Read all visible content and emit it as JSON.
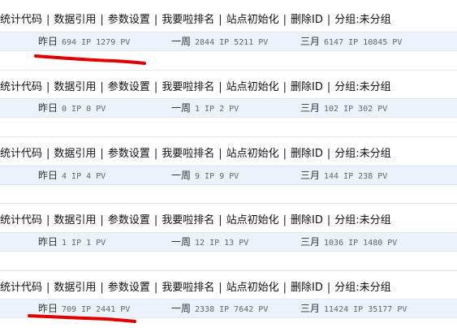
{
  "menu": {
    "stats_code": "统计代码",
    "data_ref": "数据引用",
    "param_settings": "参数设置",
    "rank": "我要啦排名",
    "init_site": "站点初始化",
    "delete_id": "删除ID",
    "separator": "|"
  },
  "labels": {
    "yesterday": "昨日",
    "week": "一周",
    "month": "三月"
  },
  "sites": [
    {
      "group": "分组:未分组",
      "yesterday": "694 IP 1279 PV",
      "week": "2844 IP 5211 PV",
      "month": "6147 IP 10845 PV"
    },
    {
      "group": "分组:未分组",
      "yesterday": "0 IP 0 PV",
      "week": "1 IP 2 PV",
      "month": "102 IP 302 PV"
    },
    {
      "group": "分组:未分组",
      "yesterday": "4 IP 4 PV",
      "week": "9 IP 9 PV",
      "month": "144 IP 238 PV"
    },
    {
      "group": "分组:未分组",
      "yesterday": "1 IP 1 PV",
      "week": "12 IP 13 PV",
      "month": "1036 IP 1480 PV"
    },
    {
      "group": "分组:未分组",
      "yesterday": "709 IP 2441 PV",
      "week": "2338 IP 7642 PV",
      "month": "11424 IP 35177 PV"
    }
  ],
  "colors": {
    "highlight_stroke": "#e00000",
    "stats_row_bg": "#ebf2fa"
  }
}
